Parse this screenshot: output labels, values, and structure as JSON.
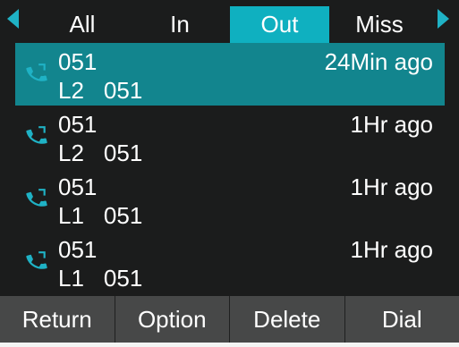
{
  "tabs": [
    {
      "label": "All",
      "active": false
    },
    {
      "label": "In",
      "active": false
    },
    {
      "label": "Out",
      "active": true
    },
    {
      "label": "Miss",
      "active": false
    }
  ],
  "calls": [
    {
      "number": "051",
      "time": "24Min ago",
      "line": "L2",
      "detail": "051",
      "selected": true
    },
    {
      "number": "051",
      "time": "1Hr ago",
      "line": "L2",
      "detail": "051",
      "selected": false
    },
    {
      "number": "051",
      "time": "1Hr ago",
      "line": "L1",
      "detail": "051",
      "selected": false
    },
    {
      "number": "051",
      "time": "1Hr ago",
      "line": "L1",
      "detail": "051",
      "selected": false
    }
  ],
  "softkeys": {
    "return": "Return",
    "option": "Option",
    "delete": "Delete",
    "dial": "Dial"
  },
  "icons": {
    "nav_left": "left-arrow-icon",
    "nav_right": "right-arrow-icon",
    "call": "outgoing-call-icon"
  },
  "colors": {
    "accent": "#0fb0c0",
    "selected_row": "#12858e",
    "background": "#1b1c1c",
    "softkey_bar": "#474848"
  }
}
